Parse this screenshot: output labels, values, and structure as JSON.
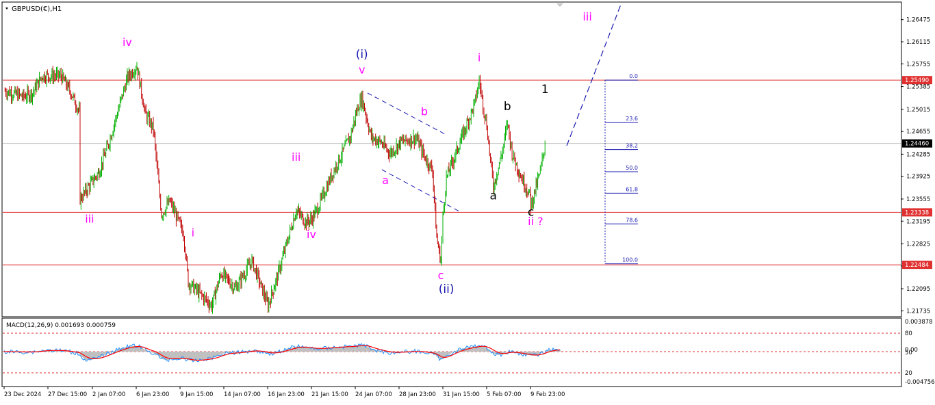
{
  "window": {
    "symbol_title": "GBPUSD(€),H1"
  },
  "macd": {
    "label": "MACD(12,26,9) 0.001693 0.000759",
    "scale_labels": [
      "0.003878",
      "80",
      "0.00",
      "50",
      "20",
      "-0.004756"
    ],
    "colors": {
      "histogram": "#c0c0c0",
      "macd_line": "#1e90ff",
      "signal_line": "#ff0000"
    }
  },
  "chart_data": [
    {
      "type": "candlestick",
      "title": "GBPUSD(€),H1",
      "y_ticks": [
        "1.26475",
        "1.26115",
        "1.25755",
        "1.25385",
        "1.25015",
        "1.24655",
        "1.24285",
        "1.23925",
        "1.23555",
        "1.23195",
        "1.22825",
        "1.22465",
        "1.22095",
        "1.21735"
      ],
      "ylim": [
        1.2165,
        1.2675
      ],
      "x_ticks": [
        "23 Dec 2024",
        "27 Dec 15:00",
        "2 Jan 07:00",
        "6 Jan 23:00",
        "9 Jan 15:00",
        "14 Jan 07:00",
        "16 Jan 23:00",
        "21 Jan 15:00",
        "24 Jan 07:00",
        "28 Jan 23:00",
        "31 Jan 15:00",
        "5 Feb 07:00",
        "9 Feb 23:00"
      ],
      "price_path": [
        {
          "x": "23 Dec 2024",
          "y": 1.2532
        },
        {
          "x": "25 Dec",
          "y": 1.2522
        },
        {
          "x": "26 Dec",
          "y": 1.2528
        },
        {
          "x": "27 Dec",
          "y": 1.2556
        },
        {
          "x": "29 Dec",
          "y": 1.2556
        },
        {
          "x": "30 Dec",
          "y": 1.253
        },
        {
          "x": "31 Dec",
          "y": 1.2495
        },
        {
          "x": "1 Jan",
          "y": 1.2355
        },
        {
          "x": "2 Jan",
          "y": 1.2378
        },
        {
          "x": "3 Jan",
          "y": 1.24
        },
        {
          "x": "4 Jan",
          "y": 1.2445
        },
        {
          "x": "6 Jan",
          "y": 1.2552
        },
        {
          "x": "7 Jan",
          "y": 1.2572
        },
        {
          "x": "7 Jan 12:00",
          "y": 1.2495
        },
        {
          "x": "8 Jan",
          "y": 1.247
        },
        {
          "x": "8 Jan 12:00",
          "y": 1.233
        },
        {
          "x": "9 Jan",
          "y": 1.2352
        },
        {
          "x": "10 Jan",
          "y": 1.23
        },
        {
          "x": "10 Jan 12:00",
          "y": 1.222
        },
        {
          "x": "13 Jan",
          "y": 1.2182
        },
        {
          "x": "14 Jan",
          "y": 1.2235
        },
        {
          "x": "15 Jan",
          "y": 1.221
        },
        {
          "x": "16 Jan",
          "y": 1.2255
        },
        {
          "x": "17 Jan",
          "y": 1.2182
        },
        {
          "x": "18 Jan",
          "y": 1.223
        },
        {
          "x": "20 Jan",
          "y": 1.2338
        },
        {
          "x": "21 Jan",
          "y": 1.2318
        },
        {
          "x": "21 Jan 15:00",
          "y": 1.2322
        },
        {
          "x": "22 Jan",
          "y": 1.234
        },
        {
          "x": "23 Jan",
          "y": 1.2403
        },
        {
          "x": "24 Jan",
          "y": 1.2458
        },
        {
          "x": "24 Jan 12:00",
          "y": 1.2502
        },
        {
          "x": "25 Jan",
          "y": 1.252
        },
        {
          "x": "26 Jan",
          "y": 1.2456
        },
        {
          "x": "27 Jan",
          "y": 1.2448
        },
        {
          "x": "28 Jan",
          "y": 1.243
        },
        {
          "x": "28 Jan 23:00",
          "y": 1.2445
        },
        {
          "x": "29 Jan",
          "y": 1.2448
        },
        {
          "x": "30 Jan",
          "y": 1.2455
        },
        {
          "x": "30 Jan 12:00",
          "y": 1.2425
        },
        {
          "x": "31 Jan",
          "y": 1.2402
        },
        {
          "x": "31 Jan 06:00",
          "y": 1.2292
        },
        {
          "x": "31 Jan 12:00",
          "y": 1.2255
        },
        {
          "x": "31 Jan 15:00",
          "y": 1.2325
        },
        {
          "x": "1 Feb",
          "y": 1.239
        },
        {
          "x": "2 Feb",
          "y": 1.243
        },
        {
          "x": "3 Feb",
          "y": 1.247
        },
        {
          "x": "4 Feb",
          "y": 1.251
        },
        {
          "x": "4 Feb 12:00",
          "y": 1.2548
        },
        {
          "x": "5 Feb",
          "y": 1.25
        },
        {
          "x": "5 Feb 07:00",
          "y": 1.2475
        },
        {
          "x": "6 Feb",
          "y": 1.2375
        },
        {
          "x": "7 Feb",
          "y": 1.2435
        },
        {
          "x": "7 Feb 12:00",
          "y": 1.248
        },
        {
          "x": "8 Feb",
          "y": 1.243
        },
        {
          "x": "9 Feb",
          "y": 1.239
        },
        {
          "x": "9 Feb 23:00",
          "y": 1.236
        },
        {
          "x": "10 Feb",
          "y": 1.2345
        },
        {
          "x": "11 Feb",
          "y": 1.24
        },
        {
          "x": "11 Feb 12:00",
          "y": 1.2446
        }
      ],
      "price_levels": [
        {
          "value": 1.2549,
          "label": "1.25490",
          "color": "#e03030"
        },
        {
          "value": 1.23338,
          "label": "1.23338",
          "color": "#e03030"
        },
        {
          "value": 1.22484,
          "label": "1.22484",
          "color": "#e03030"
        },
        {
          "value": 1.2446,
          "label": "1.24460",
          "color": "#000000"
        }
      ],
      "fibonacci_levels": [
        {
          "label": "0.0",
          "value": 1.2549
        },
        {
          "label": "23.6",
          "value": 1.248
        },
        {
          "label": "38.2",
          "value": 1.2436
        },
        {
          "label": "50.0",
          "value": 1.24
        },
        {
          "label": "61.8",
          "value": 1.2365
        },
        {
          "label": "78.6",
          "value": 1.2315
        },
        {
          "label": "100.0",
          "value": 1.225
        }
      ],
      "wave_labels": [
        {
          "text": "iv",
          "color": "#ff00ff",
          "x": "6 Jan",
          "y": 1.2605
        },
        {
          "text": "iii",
          "color": "#ff00ff",
          "x": "2 Jan",
          "y": 1.2317
        },
        {
          "text": "i",
          "color": "#ff00ff",
          "x": "11 Jan",
          "y": 1.2295
        },
        {
          "text": "iii",
          "color": "#ff00ff",
          "x": "20 Jan",
          "y": 1.2418
        },
        {
          "text": "iv",
          "color": "#ff00ff",
          "x": "21 Jan 15:00",
          "y": 1.2292
        },
        {
          "text": "(i)",
          "color": "#1a1ab0",
          "x": "25 Jan",
          "y": 1.2585
        },
        {
          "text": "v",
          "color": "#ff00ff",
          "x": "25 Jan",
          "y": 1.256
        },
        {
          "text": "a",
          "color": "#ff00ff",
          "x": "27 Jan 12:00",
          "y": 1.238
        },
        {
          "text": "b",
          "color": "#ff00ff",
          "x": "30 Jan 12:00",
          "y": 1.2492
        },
        {
          "text": "c",
          "color": "#ff00ff",
          "x": "31 Jan 12:00",
          "y": 1.2225
        },
        {
          "text": "(ii)",
          "color": "#1a1ab0",
          "x": "1 Feb",
          "y": 1.2203
        },
        {
          "text": "i",
          "color": "#ff00ff",
          "x": "4 Feb 12:00",
          "y": 1.258
        },
        {
          "text": "a",
          "color": "#000000",
          "x": "6 Feb",
          "y": 1.2355
        },
        {
          "text": "b",
          "color": "#000000",
          "x": "7 Feb 12:00",
          "y": 1.25
        },
        {
          "text": "c",
          "color": "#000000",
          "x": "10 Feb",
          "y": 1.2328
        },
        {
          "text": "ii ?",
          "color": "#ff00ff",
          "x": "10 Feb 12:00",
          "y": 1.2313
        },
        {
          "text": "1",
          "color": "#000000",
          "x": "11 Feb 12:00",
          "y": 1.2528
        },
        {
          "text": "iii",
          "color": "#ff00ff",
          "x": "16 Feb",
          "y": 1.2646
        }
      ],
      "grid": false
    },
    {
      "type": "line",
      "title": "MACD(12,26,9) 0.001693 0.000759",
      "legend": [
        "MACD(12,26,9)"
      ]
    }
  ]
}
